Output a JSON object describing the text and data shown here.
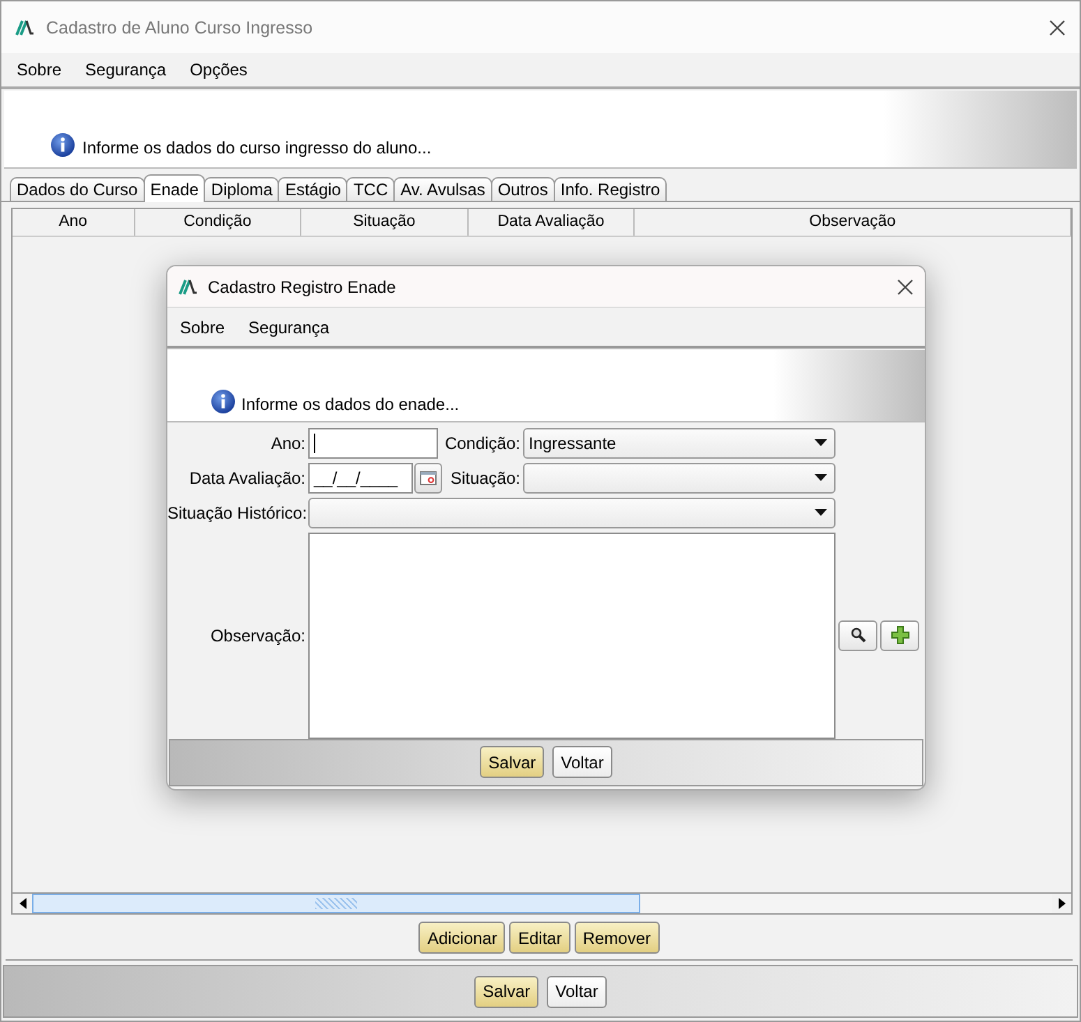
{
  "window": {
    "title": "Cadastro de Aluno Curso Ingresso"
  },
  "menu": [
    "Sobre",
    "Segurança",
    "Opções"
  ],
  "banner": {
    "message": "Informe os dados do curso ingresso do aluno..."
  },
  "tabs": [
    {
      "label": "Dados do Curso",
      "selected": false
    },
    {
      "label": "Enade",
      "selected": true
    },
    {
      "label": "Diploma",
      "selected": false
    },
    {
      "label": "Estágio",
      "selected": false
    },
    {
      "label": "TCC",
      "selected": false
    },
    {
      "label": "Av. Avulsas",
      "selected": false
    },
    {
      "label": "Outros",
      "selected": false
    },
    {
      "label": "Info. Registro",
      "selected": false
    }
  ],
  "table": {
    "columns": [
      "Ano",
      "Condição",
      "Situação",
      "Data Avaliação",
      "Observação"
    ]
  },
  "table_buttons": [
    {
      "label": "Adicionar",
      "kind": "primary"
    },
    {
      "label": "Editar",
      "kind": "primary"
    },
    {
      "label": "Remover",
      "kind": "primary"
    }
  ],
  "footer_buttons": [
    {
      "label": "Salvar",
      "kind": "primary"
    },
    {
      "label": "Voltar",
      "kind": "plain"
    }
  ],
  "dialog": {
    "title": "Cadastro Registro Enade",
    "menu": [
      "Sobre",
      "Segurança"
    ],
    "banner": {
      "message": "Informe os dados do enade..."
    },
    "rows": [
      {
        "fields": [
          {
            "label": "Ano:",
            "kind": "text",
            "focused": true
          },
          {
            "label": "Condição:",
            "kind": "select",
            "value": "Ingressante"
          }
        ]
      },
      {
        "fields": [
          {
            "label": "Data Avaliação:",
            "kind": "date",
            "value": "__/__/____"
          },
          {
            "label": "Situação:",
            "kind": "select"
          }
        ]
      },
      {
        "fields": [
          {
            "label": "Situação Histórico:",
            "kind": "select"
          }
        ]
      },
      {
        "fields": [
          {
            "label": "Observação:",
            "kind": "textarea"
          }
        ],
        "actions": [
          {
            "kind": "search"
          },
          {
            "kind": "add"
          }
        ]
      }
    ],
    "buttons": [
      {
        "label": "Salvar",
        "kind": "primary"
      },
      {
        "label": "Voltar",
        "kind": "plain"
      }
    ]
  }
}
